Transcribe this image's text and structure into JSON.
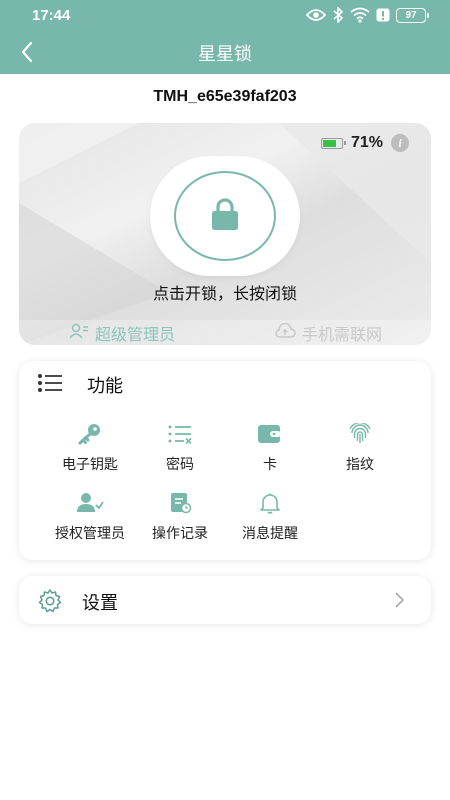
{
  "status_bar": {
    "time": "17:44",
    "icons": [
      "eye-icon",
      "bluetooth-icon",
      "wifi-icon",
      "alert-icon"
    ],
    "battery": "97"
  },
  "nav": {
    "title": "星星锁",
    "back_icon": "back-arrow-icon"
  },
  "device": {
    "id": "TMH_e65e39faf203"
  },
  "lock_card": {
    "battery_level": 0.71,
    "battery_percent": "71%",
    "battery_fill_color": "#37c247",
    "info_icon": "i",
    "lock_icon": "padlock-icon",
    "hint": "点击开锁，长按闭锁",
    "role": "超级管理员",
    "network_status": "手机需联网"
  },
  "functions": {
    "title": "功能",
    "items": [
      {
        "label": "电子钥匙",
        "icon": "key-icon"
      },
      {
        "label": "密码",
        "icon": "password-icon"
      },
      {
        "label": "卡",
        "icon": "card-icon"
      },
      {
        "label": "指纹",
        "icon": "fingerprint-icon"
      },
      {
        "label": "授权管理员",
        "icon": "authorized-admin-icon"
      },
      {
        "label": "操作记录",
        "icon": "operation-log-icon"
      },
      {
        "label": "消息提醒",
        "icon": "bell-icon"
      }
    ]
  },
  "settings": {
    "label": "设置",
    "icon": "gear-icon"
  },
  "colors": {
    "primary": "#78b8ab",
    "accent_text": "#8cc5b8",
    "muted_text": "#c8c8c8"
  }
}
